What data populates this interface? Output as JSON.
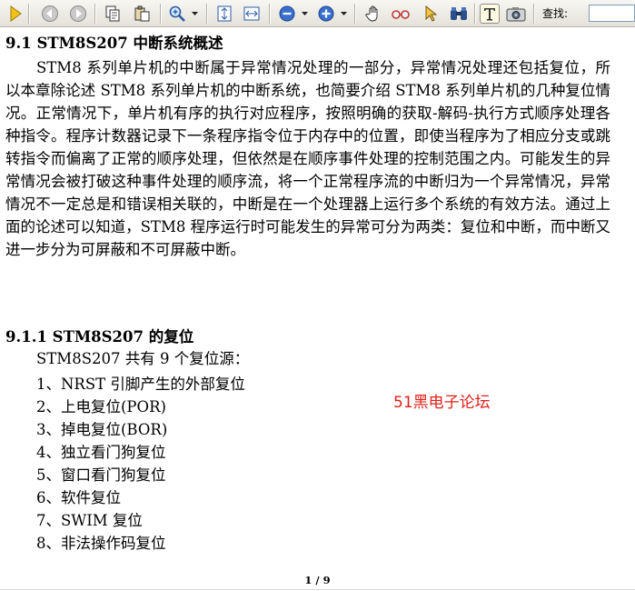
{
  "toolbar": {
    "find_label": "查找:",
    "find_value": ""
  },
  "icons": {
    "play": "play-icon",
    "prev": "prev-page-icon",
    "next": "next-page-icon",
    "copy": "copy-icon",
    "paste": "paste-icon",
    "zoom": "zoom-icon",
    "fit_page": "fit-page-icon",
    "fit_width": "fit-width-icon",
    "zoom_out": "zoom-out-icon",
    "zoom_in": "zoom-in-icon",
    "hand": "hand-icon",
    "glasses": "glasses-icon",
    "pointer": "pointer-icon",
    "binoculars": "binoculars-icon",
    "text_select": "text-select-icon",
    "snapshot": "snapshot-icon"
  },
  "document": {
    "heading1": "9.1  STM8S207 中断系统概述",
    "paragraph": "STM8 系列单片机的中断属于异常情况处理的一部分，异常情况处理还包括复位，所以本章除论述 STM8 系列单片机的中断系统，也简要介绍 STM8 系列单片机的几种复位情况。正常情况下，单片机有序的执行对应程序，按照明确的获取-解码-执行方式顺序处理各种指令。程序计数器记录下一条程序指令位于内存中的位置，即使当程序为了相应分支或跳转指令而偏离了正常的顺序处理，但依然是在顺序事件处理的控制范围之内。可能发生的异常情况会被打破这种事件处理的顺序流，将一个正常程序流的中断归为一个异常情况，异常情况不一定总是和错误相关联的，中断是在一个处理器上运行多个系统的有效方法。通过上面的论述可以知道，STM8 程序运行时可能发生的异常可分为两类：复位和中断，而中断又进一步分为可屏蔽和不可屏蔽中断。",
    "heading2": "9.1.1 STM8S207 的复位",
    "intro": "STM8S207 共有 9 个复位源：",
    "reset_sources": [
      "1、NRST 引脚产生的外部复位",
      "2、上电复位(POR)",
      "3、掉电复位(BOR)",
      "4、独立看门狗复位",
      "5、窗口看门狗复位",
      "6、软件复位",
      "7、SWIM 复位",
      "8、非法操作码复位"
    ],
    "watermark": "51黑电子论坛",
    "page_indicator": "1 / 9"
  }
}
